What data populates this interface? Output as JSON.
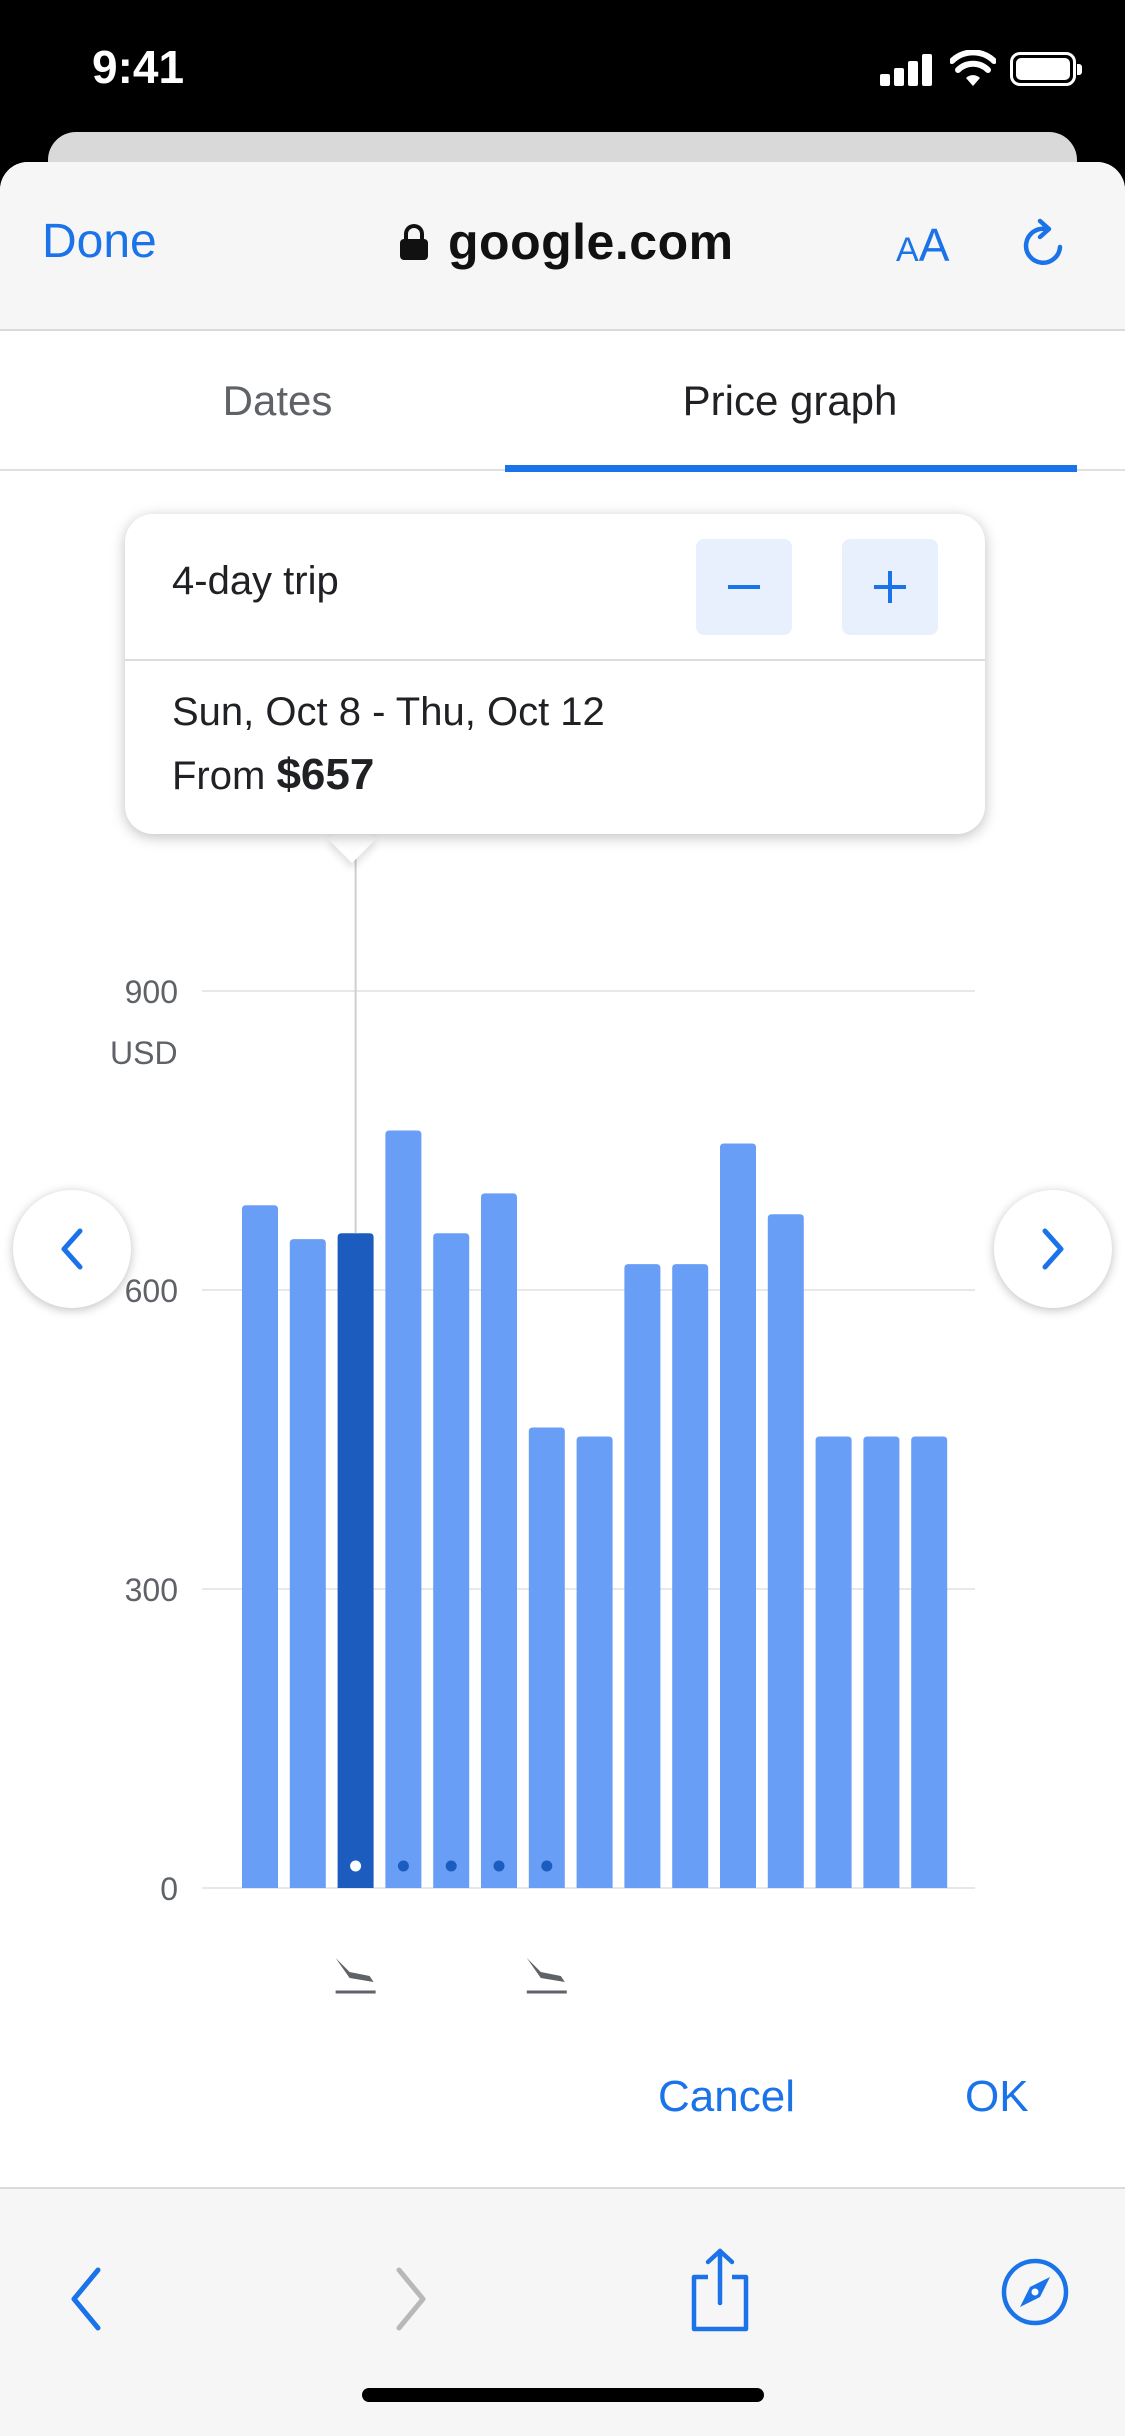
{
  "status_bar": {
    "time": "9:41"
  },
  "browser": {
    "done_label": "Done",
    "url": "google.com",
    "aa_small": "A",
    "aa_big": "A"
  },
  "tabs": [
    {
      "label": "Dates",
      "selected": false
    },
    {
      "label": "Price graph",
      "selected": true
    }
  ],
  "trip_card": {
    "trip_length": "4-day trip",
    "dates": "Sun, Oct 8 - Thu, Oct 12",
    "from_label": "From",
    "price": "$657"
  },
  "chart_data": {
    "type": "bar",
    "ylabel": "USD",
    "ylim": [
      0,
      900
    ],
    "yticks": [
      0,
      300,
      600,
      900
    ],
    "grid": true,
    "values": [
      685,
      651,
      657,
      760,
      657,
      697,
      462,
      453,
      626,
      626,
      747,
      676,
      453,
      453,
      453
    ],
    "selected_index": 2,
    "trip_dot_indices": [
      2,
      3,
      4,
      5,
      6
    ],
    "departure_marker_index": 2,
    "return_marker_index": 6
  },
  "actions": {
    "cancel_label": "Cancel",
    "ok_label": "OK"
  },
  "colors": {
    "accent": "#1a73e8",
    "bar": "#689ef5",
    "bar_selected": "#1b5cbe",
    "grid": "#e8e8e8",
    "axis_text": "#5f6368"
  }
}
